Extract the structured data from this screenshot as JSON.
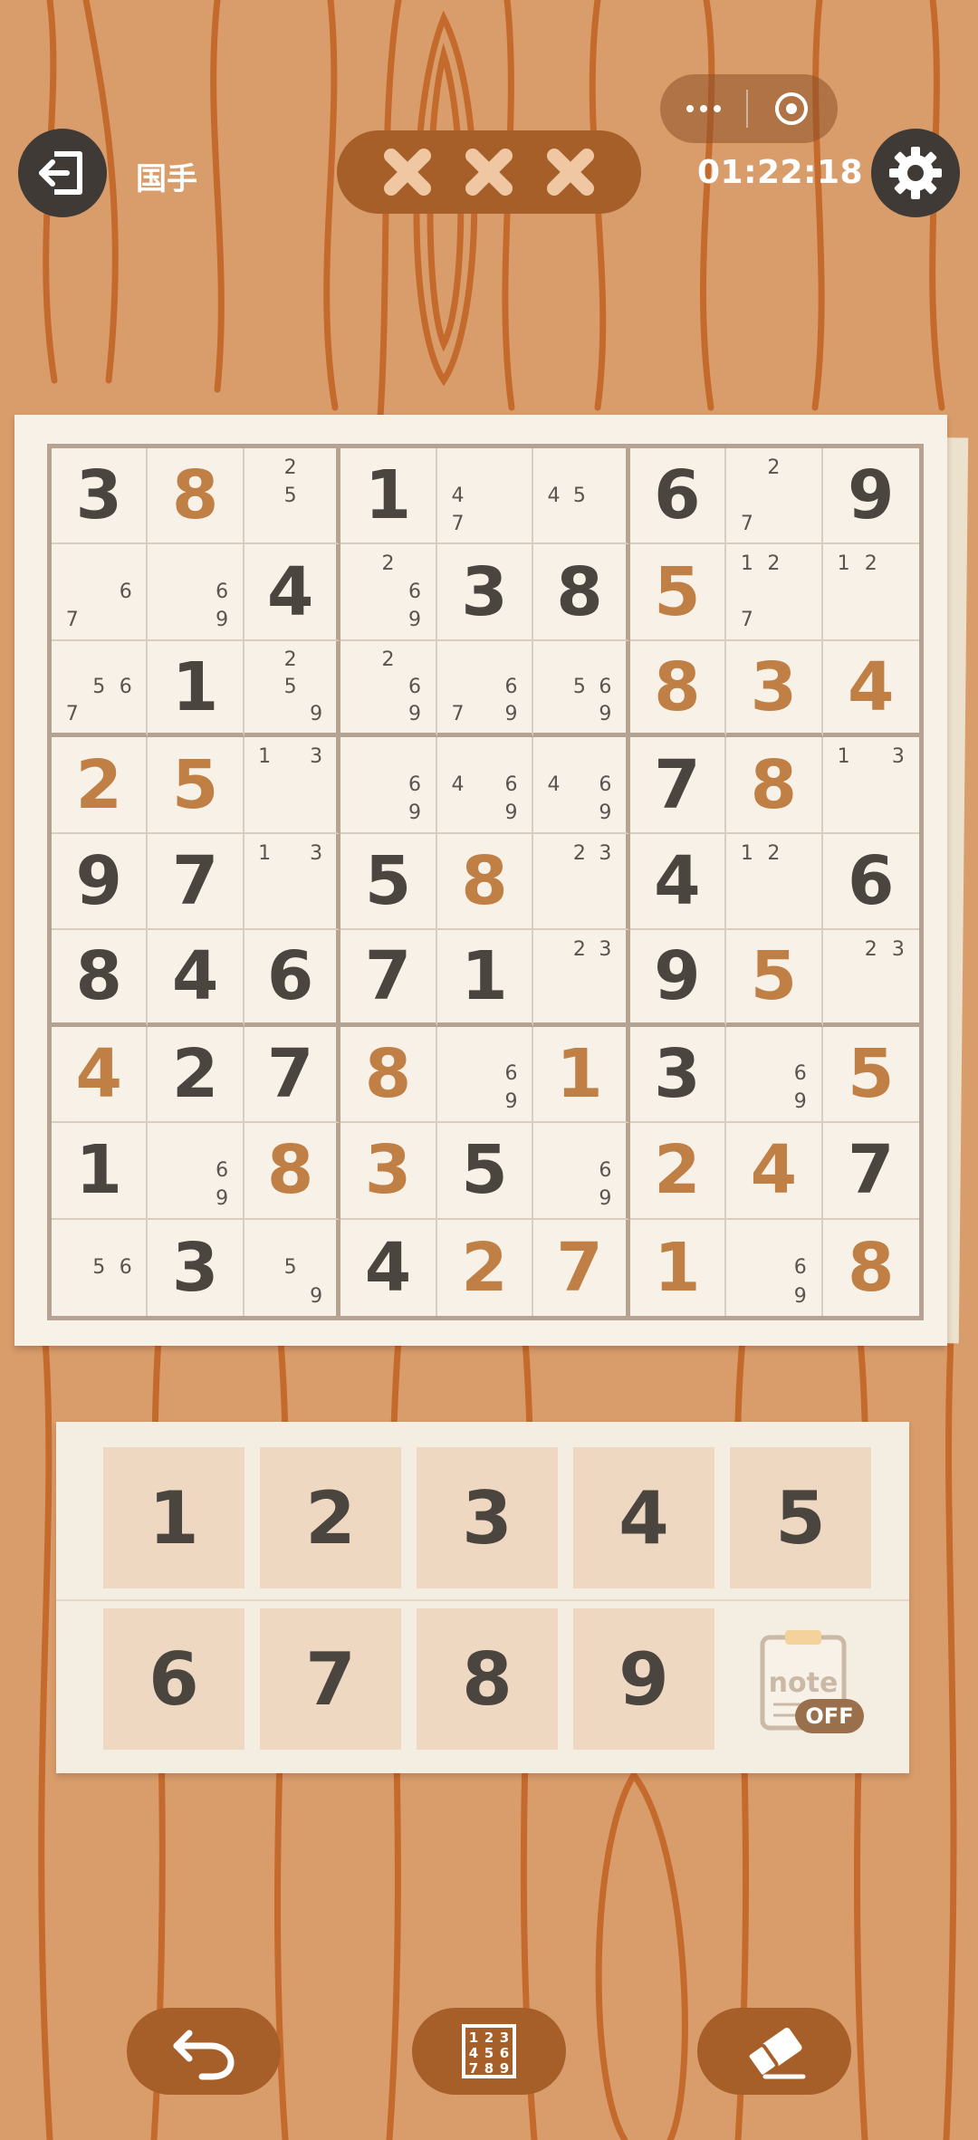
{
  "header": {
    "level": "国手",
    "timer": "01:22:18",
    "mistakes": 3,
    "icons": {
      "exit": "exit-icon",
      "settings": "gear-icon",
      "more": "more-dots-icon",
      "record": "record-icon",
      "mistake": "x-icon"
    }
  },
  "board": {
    "grid": [
      [
        3,
        8,
        0,
        1,
        0,
        0,
        6,
        0,
        9
      ],
      [
        0,
        0,
        4,
        0,
        3,
        8,
        5,
        0,
        0
      ],
      [
        0,
        1,
        0,
        0,
        0,
        0,
        8,
        3,
        4
      ],
      [
        2,
        5,
        0,
        0,
        0,
        0,
        7,
        8,
        0
      ],
      [
        9,
        7,
        0,
        5,
        8,
        0,
        4,
        0,
        6
      ],
      [
        8,
        4,
        6,
        7,
        1,
        0,
        9,
        5,
        0
      ],
      [
        4,
        2,
        7,
        8,
        0,
        1,
        3,
        0,
        5
      ],
      [
        1,
        0,
        8,
        3,
        5,
        0,
        2,
        4,
        7
      ],
      [
        0,
        3,
        0,
        4,
        2,
        7,
        1,
        0,
        8
      ]
    ],
    "user_entered": [
      [
        0,
        1,
        0,
        0,
        0,
        0,
        0,
        0,
        0
      ],
      [
        0,
        0,
        0,
        0,
        0,
        0,
        1,
        0,
        0
      ],
      [
        0,
        0,
        0,
        0,
        0,
        0,
        1,
        1,
        1
      ],
      [
        1,
        1,
        0,
        0,
        0,
        0,
        0,
        1,
        0
      ],
      [
        0,
        0,
        0,
        0,
        1,
        0,
        0,
        0,
        0
      ],
      [
        0,
        0,
        0,
        0,
        0,
        0,
        0,
        1,
        0
      ],
      [
        1,
        0,
        0,
        1,
        0,
        1,
        0,
        0,
        1
      ],
      [
        0,
        0,
        1,
        1,
        0,
        0,
        1,
        1,
        0
      ],
      [
        0,
        0,
        0,
        0,
        1,
        1,
        1,
        0,
        1
      ]
    ],
    "notes": {
      "0-2": [
        2,
        5
      ],
      "0-4": [
        4,
        7
      ],
      "0-5": [
        4,
        5
      ],
      "0-7": [
        2,
        7
      ],
      "1-0": [
        6,
        7
      ],
      "1-1": [
        6,
        9
      ],
      "1-3": [
        2,
        6,
        9
      ],
      "1-7": [
        1,
        2,
        7
      ],
      "1-8": [
        1,
        2
      ],
      "2-0": [
        5,
        6,
        7
      ],
      "2-2": [
        2,
        5,
        9
      ],
      "2-3": [
        2,
        6,
        9
      ],
      "2-4": [
        6,
        7,
        9
      ],
      "2-5": [
        5,
        6,
        9
      ],
      "3-2": [
        1,
        3
      ],
      "3-3": [
        6,
        9
      ],
      "3-4": [
        4,
        6,
        9
      ],
      "3-5": [
        4,
        6,
        9
      ],
      "3-8": [
        1,
        3
      ],
      "4-2": [
        1,
        3
      ],
      "4-5": [
        2,
        3
      ],
      "4-7": [
        1,
        2
      ],
      "5-5": [
        2,
        3
      ],
      "5-8": [
        2,
        3
      ],
      "6-4": [
        6,
        9
      ],
      "6-7": [
        6,
        9
      ],
      "7-1": [
        6,
        9
      ],
      "7-5": [
        6,
        9
      ],
      "8-0": [
        5,
        6
      ],
      "8-2": [
        5,
        9
      ],
      "8-7": [
        6,
        9
      ]
    }
  },
  "numpad": {
    "keys": [
      "1",
      "2",
      "3",
      "4",
      "5",
      "6",
      "7",
      "8",
      "9"
    ],
    "note_label": "note",
    "note_state": "OFF"
  },
  "actions": {
    "undo_icon": "undo-icon",
    "candidates_icon": "candidates-grid-icon",
    "erase_icon": "eraser-icon"
  },
  "colors": {
    "background": "#d99d6c",
    "wood_line": "#c56a2d",
    "given_digit": "#4b4540",
    "user_digit": "#bf7f45",
    "pill": "#a75f2a"
  }
}
